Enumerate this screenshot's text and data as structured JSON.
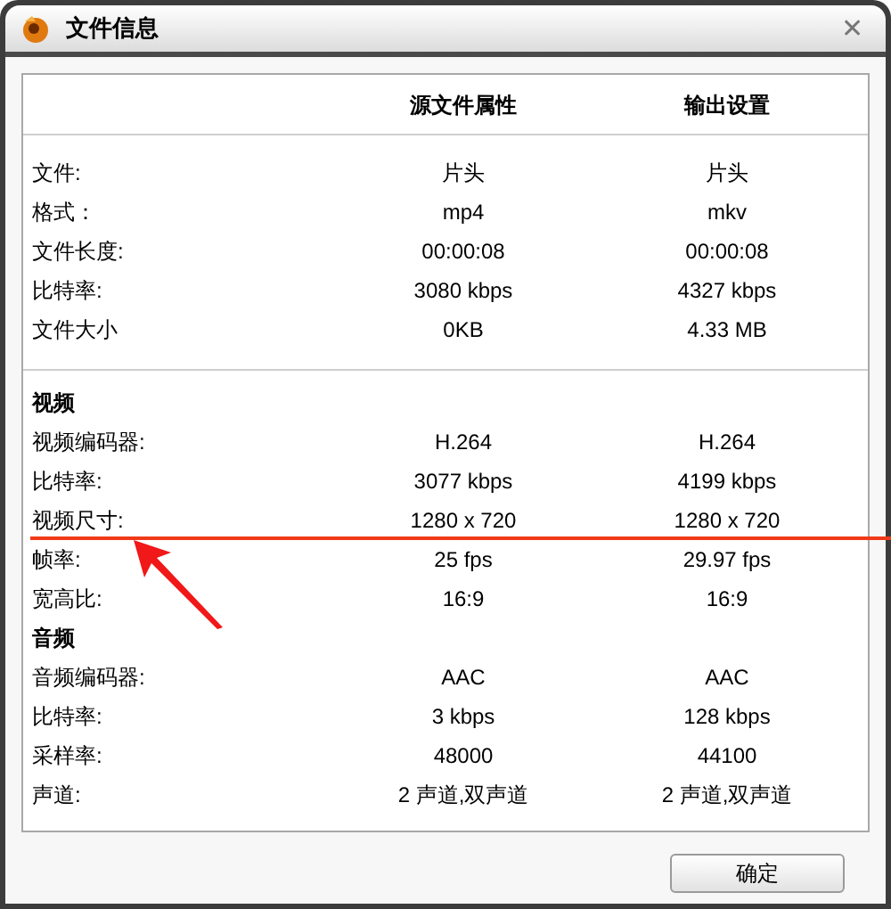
{
  "window": {
    "title": "文件信息",
    "close": "✕"
  },
  "table": {
    "columns": [
      "源文件属性",
      "输出设置"
    ],
    "sections": [
      {
        "rows": [
          {
            "label": "文件:",
            "source": "片头",
            "output": "片头"
          },
          {
            "label": "格式：",
            "source": "mp4",
            "output": "mkv"
          },
          {
            "label": "文件长度:",
            "source": "00:00:08",
            "output": "00:00:08"
          },
          {
            "label": "比特率:",
            "source": "3080 kbps",
            "output": "4327 kbps"
          },
          {
            "label": "文件大小",
            "source": "0KB",
            "output": "4.33 MB"
          }
        ]
      },
      {
        "heading": "视频",
        "rows": [
          {
            "label": "视频编码器:",
            "source": "H.264",
            "output": "H.264"
          },
          {
            "label": "比特率:",
            "source": "3077 kbps",
            "output": "4199 kbps"
          },
          {
            "label": "视频尺寸:",
            "source": "1280 x 720",
            "output": "1280 x 720"
          },
          {
            "label": "帧率:",
            "source": "25 fps",
            "output": "29.97 fps"
          },
          {
            "label": "宽高比:",
            "source": "16:9",
            "output": "16:9"
          }
        ]
      },
      {
        "heading": "音频",
        "rows": [
          {
            "label": "音频编码器:",
            "source": "AAC",
            "output": "AAC"
          },
          {
            "label": "比特率:",
            "source": "3 kbps",
            "output": "128 kbps"
          },
          {
            "label": "采样率:",
            "source": "48000",
            "output": "44100"
          },
          {
            "label": "声道:",
            "source": "2 声道,双声道",
            "output": "2 声道,双声道"
          }
        ]
      }
    ]
  },
  "buttons": [
    "确定"
  ]
}
